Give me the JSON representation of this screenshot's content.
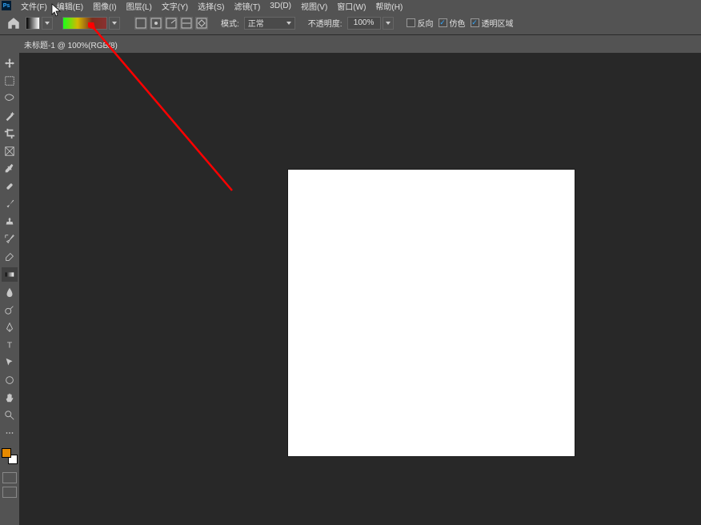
{
  "menu": {
    "items": [
      "文件(F)",
      "编辑(E)",
      "图像(I)",
      "图层(L)",
      "文字(Y)",
      "选择(S)",
      "滤镜(T)",
      "3D(D)",
      "视图(V)",
      "窗口(W)",
      "帮助(H)"
    ]
  },
  "options": {
    "mode_label": "模式:",
    "mode_value": "正常",
    "opacity_label": "不透明度:",
    "opacity_value": "100%",
    "reverse": "反向",
    "dither": "仿色",
    "transparency": "透明区域"
  },
  "doc_tab": "未标题-1 @ 100%(RGB/8)",
  "tools": {
    "move": "move",
    "marquee": "marquee",
    "lasso": "lasso",
    "wand": "wand",
    "crop": "crop",
    "frame": "frame",
    "eyedropper": "eyedropper",
    "heal": "heal",
    "brush": "brush",
    "clone": "clone",
    "history": "history",
    "eraser": "eraser",
    "gradient": "gradient",
    "blur": "blur",
    "dodge": "dodge",
    "pen": "pen",
    "type": "type",
    "path": "path",
    "shape": "shape",
    "hand": "hand",
    "zoom": "zoom"
  }
}
